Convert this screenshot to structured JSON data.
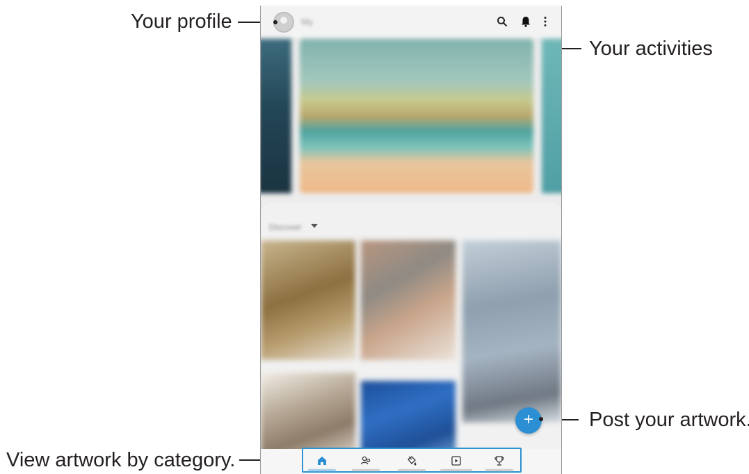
{
  "annotations": {
    "profile": "Your profile",
    "activities": "Your activities",
    "post": "Post your artwork.",
    "category": "View artwork by category."
  },
  "app": {
    "username": "My",
    "feed_filter": "Discover",
    "fab_symbol": "+",
    "header_icons": [
      "search-icon",
      "bell-icon",
      "more-options-icon"
    ],
    "nav_icons": [
      "home-icon",
      "people-icon",
      "paint-bucket-icon",
      "play-icon",
      "trophy-icon"
    ]
  },
  "colors": {
    "accent": "#2d8fd3",
    "highlight_box": "#2d93cf",
    "annotation_text": "#231f20"
  }
}
